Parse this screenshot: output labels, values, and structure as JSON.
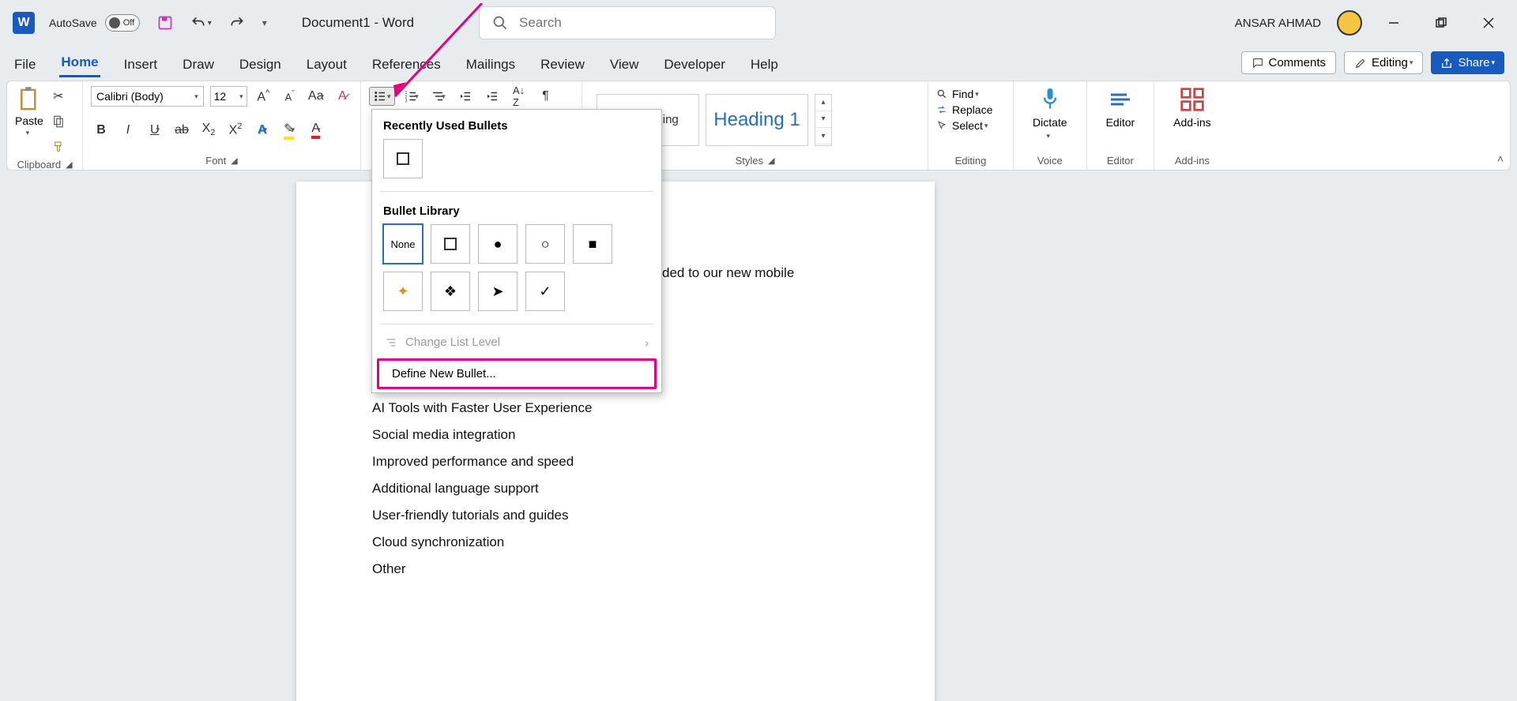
{
  "title": {
    "autosave": "AutoSave",
    "autosave_state": "Off",
    "doc": "Document1  -  Word"
  },
  "search": {
    "placeholder": "Search"
  },
  "user": {
    "name": "ANSAR AHMAD"
  },
  "tabs": {
    "file": "File",
    "home": "Home",
    "insert": "Insert",
    "draw": "Draw",
    "design": "Design",
    "layout": "Layout",
    "references": "References",
    "mailings": "Mailings",
    "review": "Review",
    "view": "View",
    "developer": "Developer",
    "help": "Help"
  },
  "tabs_right": {
    "comments": "Comments",
    "editing": "Editing",
    "share": "Share"
  },
  "ribbon": {
    "clipboard": {
      "paste": "Paste",
      "label": "Clipboard"
    },
    "font": {
      "name": "Calibri (Body)",
      "size": "12",
      "label": "Font"
    },
    "styles": {
      "no_spacing": "No Spacing",
      "heading1": "Heading 1",
      "label": "Styles"
    },
    "editing": {
      "find": "Find",
      "replace": "Replace",
      "select": "Select",
      "label": "Editing"
    },
    "voice": {
      "dictate": "Dictate",
      "label": "Voice"
    },
    "editor": {
      "editor": "Editor",
      "label": "Editor"
    },
    "addins": {
      "addins": "Add-ins",
      "label": "Add-ins"
    }
  },
  "dropdown": {
    "recent_title": "Recently Used Bullets",
    "library_title": "Bullet Library",
    "none": "None",
    "change_level": "Change List Level",
    "define_new": "Define New Bullet..."
  },
  "doc": {
    "frag_right": "ded to our new mobile",
    "lines": [
      "AI Tools with Faster User Experience",
      "Social media integration",
      "Improved performance and speed",
      "Additional language support",
      "User-friendly tutorials and guides",
      "Cloud synchronization",
      "Other"
    ]
  }
}
